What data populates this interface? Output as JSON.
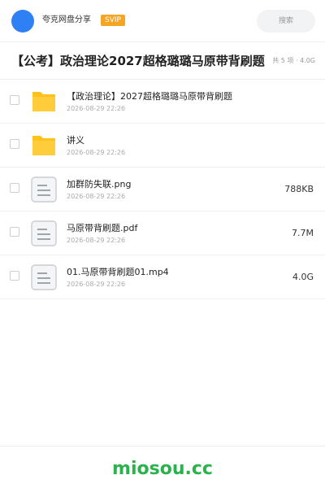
{
  "header": {
    "share_name": "夸克网盘分享",
    "badge": "SVIP",
    "search_placeholder": "搜索"
  },
  "folder": {
    "title": "【公考】政治理论2027超格璐璐马原带背刷题",
    "meta": "共 5 项 · 4.0G"
  },
  "files": [
    {
      "name": "【政治理论】2027超格璐璐马原带背刷题",
      "date": "2026-08-29 22:26",
      "size": "",
      "icon": "folder-icon"
    },
    {
      "name": "讲义",
      "date": "2026-08-29 22:26",
      "size": "",
      "icon": "folder-icon"
    },
    {
      "name": "加群防失联.png",
      "date": "2026-08-29 22:26",
      "size": "788KB",
      "icon": "file-icon"
    },
    {
      "name": "马原带背刷题.pdf",
      "date": "2026-08-29 22:26",
      "size": "7.7M",
      "icon": "file-icon"
    },
    {
      "name": "01.马原带背刷题01.mp4",
      "date": "2026-08-29 22:26",
      "size": "4.0G",
      "icon": "file-icon"
    }
  ],
  "footer": {
    "brand": "miosou.cc"
  },
  "colors": {
    "accent_blue": "#2f7ff5",
    "svip_orange": "#f5a524",
    "folder_yellow": "#ffc21a",
    "brand_green": "#2bb24c"
  }
}
